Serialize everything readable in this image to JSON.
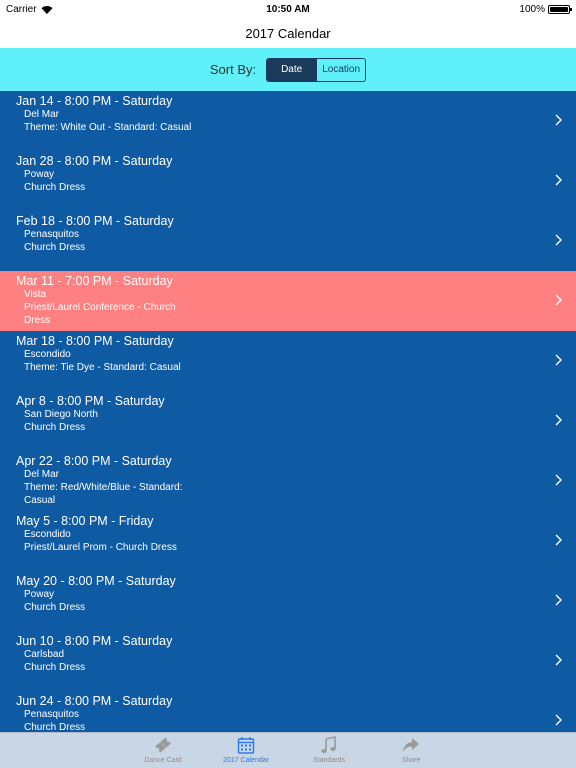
{
  "status": {
    "carrier": "Carrier",
    "time": "10:50 AM",
    "battery": "100%"
  },
  "nav": {
    "title": "2017 Calendar"
  },
  "sort": {
    "label": "Sort By:",
    "options": [
      "Date",
      "Location"
    ],
    "selected": "Date"
  },
  "events": [
    {
      "title": "Jan 14 - 8:00 PM - Saturday",
      "location": "Del Mar",
      "detail": "Theme: White Out - Standard: Casual"
    },
    {
      "title": "Jan 28 - 8:00 PM - Saturday",
      "location": "Poway",
      "detail": "Church Dress"
    },
    {
      "title": "Feb 18 - 8:00 PM - Saturday",
      "location": "Penasquitos",
      "detail": "Church Dress"
    },
    {
      "title": "Mar 11 - 7:00 PM - Saturday",
      "location": "Vista",
      "detail": "Priest/Laurel Conference - Church Dress"
    },
    {
      "title": "Mar 18 - 8:00 PM - Saturday",
      "location": "Escondido",
      "detail": "Theme: Tie Dye - Standard: Casual"
    },
    {
      "title": "Apr 8 - 8:00 PM - Saturday",
      "location": "San Diego North",
      "detail": "Church Dress"
    },
    {
      "title": "Apr 22 - 8:00 PM - Saturday",
      "location": "Del Mar",
      "detail": "Theme: Red/White/Blue - Standard: Casual"
    },
    {
      "title": "May 5 - 8:00 PM - Friday",
      "location": "Escondido",
      "detail": "Priest/Laurel Prom - Church Dress"
    },
    {
      "title": "May 20 - 8:00 PM - Saturday",
      "location": "Poway",
      "detail": "Church Dress"
    },
    {
      "title": "Jun 10 - 8:00 PM - Saturday",
      "location": "Carlsbad",
      "detail": "Church Dress"
    },
    {
      "title": "Jun 24 - 8:00 PM - Saturday",
      "location": "Penasquitos",
      "detail": "Church Dress"
    }
  ],
  "tabs": [
    {
      "label": "Dance Card",
      "icon": "ticket-icon"
    },
    {
      "label": "2017 Calendar",
      "icon": "calendar-icon"
    },
    {
      "label": "Standards",
      "icon": "music-note-icon"
    },
    {
      "label": "Share",
      "icon": "share-arrow-icon"
    }
  ],
  "colors": {
    "list_background": "#0f5ba3",
    "highlight_row": "#ff8080",
    "sort_bar": "#5ff0fa",
    "tab_active": "#2a7ae2"
  }
}
